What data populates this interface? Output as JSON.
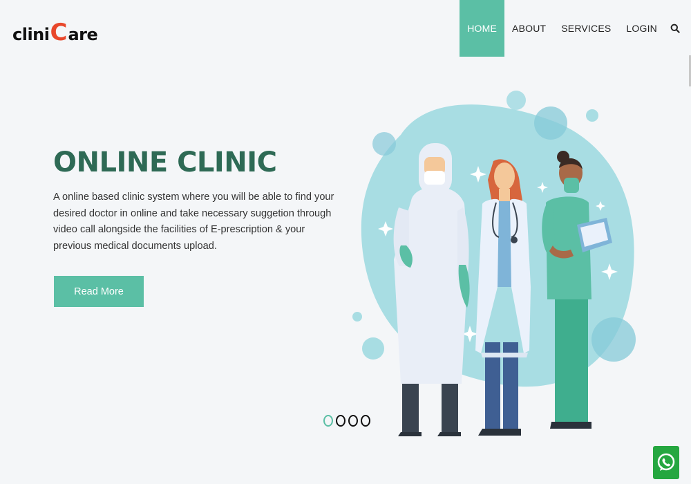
{
  "brand": {
    "part1": "clini",
    "part2": "C",
    "part3": "are"
  },
  "nav": {
    "items": [
      {
        "label": "HOME",
        "active": true
      },
      {
        "label": "ABOUT",
        "active": false
      },
      {
        "label": "SERVICES",
        "active": false
      },
      {
        "label": "LOGIN",
        "active": false
      }
    ],
    "search_icon": "search-icon"
  },
  "hero": {
    "title": "ONLINE CLINIC",
    "description": "A online based clinic system where you will be able to find your desired doctor in online and take necessary suggetion through video call alongside the facilities of E-prescription & your previous medical documents upload.",
    "button_label": "Read More",
    "illustration": "medical-staff-illustration"
  },
  "carousel": {
    "slides": 4,
    "active_index": 0
  },
  "colors": {
    "accent": "#5bbfa5",
    "title": "#2e6a55",
    "logo_c": "#e8472b",
    "background": "#f4f6f8",
    "whatsapp": "#25a740"
  },
  "floating": {
    "whatsapp_icon": "whatsapp-icon"
  }
}
